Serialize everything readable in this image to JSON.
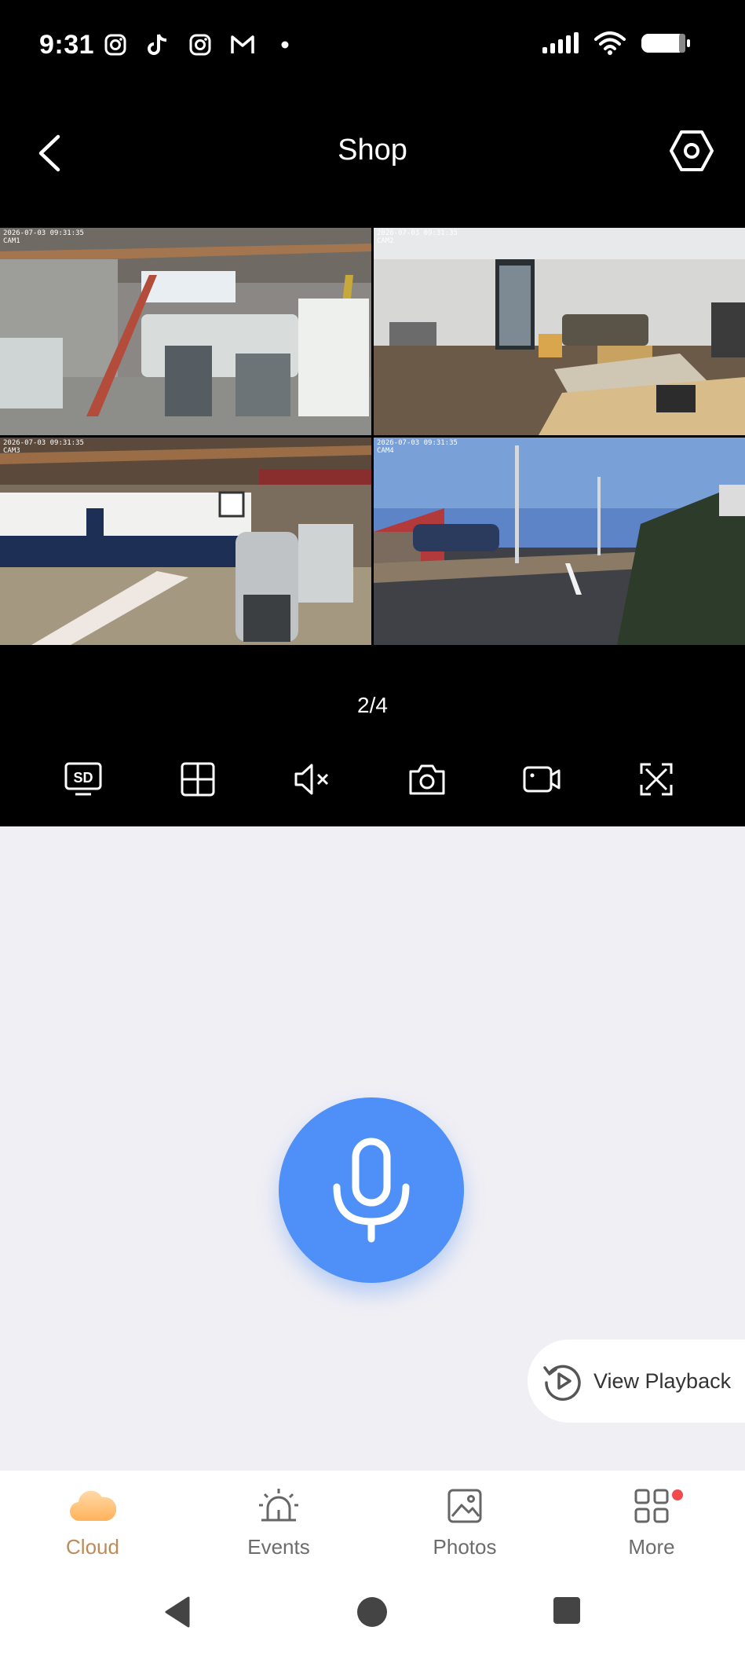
{
  "status_bar": {
    "time": "9:31",
    "left_icons": [
      "instagram-icon",
      "tiktok-icon",
      "instagram-icon",
      "gmail-icon",
      "dot-icon"
    ],
    "right_icons": [
      "signal-icon",
      "wifi-icon",
      "battery-icon"
    ]
  },
  "header": {
    "title": "Shop",
    "back_icon": "chevron-left-icon",
    "settings_icon": "hexagon-gear-icon"
  },
  "cameras": [
    {
      "timestamp": "2026-07-03 09:31:35",
      "label": "CAM1"
    },
    {
      "timestamp": "2026-07-03 09:31:35",
      "label": "CAM2"
    },
    {
      "timestamp": "2026-07-03 09:31:35",
      "label": "CAM3"
    },
    {
      "timestamp": "2026-07-03 09:31:35",
      "label": "CAM4"
    }
  ],
  "page_indicator": "2/4",
  "controls": [
    "sd-quality-icon",
    "grid-layout-icon",
    "mute-icon",
    "camera-snapshot-icon",
    "video-record-icon",
    "fullscreen-icon"
  ],
  "colors": {
    "mic_blue": "#4e90f7",
    "active_tab": "#c08a57",
    "badge_red": "#f04a4a"
  },
  "playback": {
    "label": "View Playback"
  },
  "tabs": [
    {
      "label": "Cloud",
      "icon": "cloud-icon",
      "active": true
    },
    {
      "label": "Events",
      "icon": "alarm-icon",
      "active": false
    },
    {
      "label": "Photos",
      "icon": "image-icon",
      "active": false
    },
    {
      "label": "More",
      "icon": "grid-icon",
      "active": false,
      "badge": true
    }
  ]
}
